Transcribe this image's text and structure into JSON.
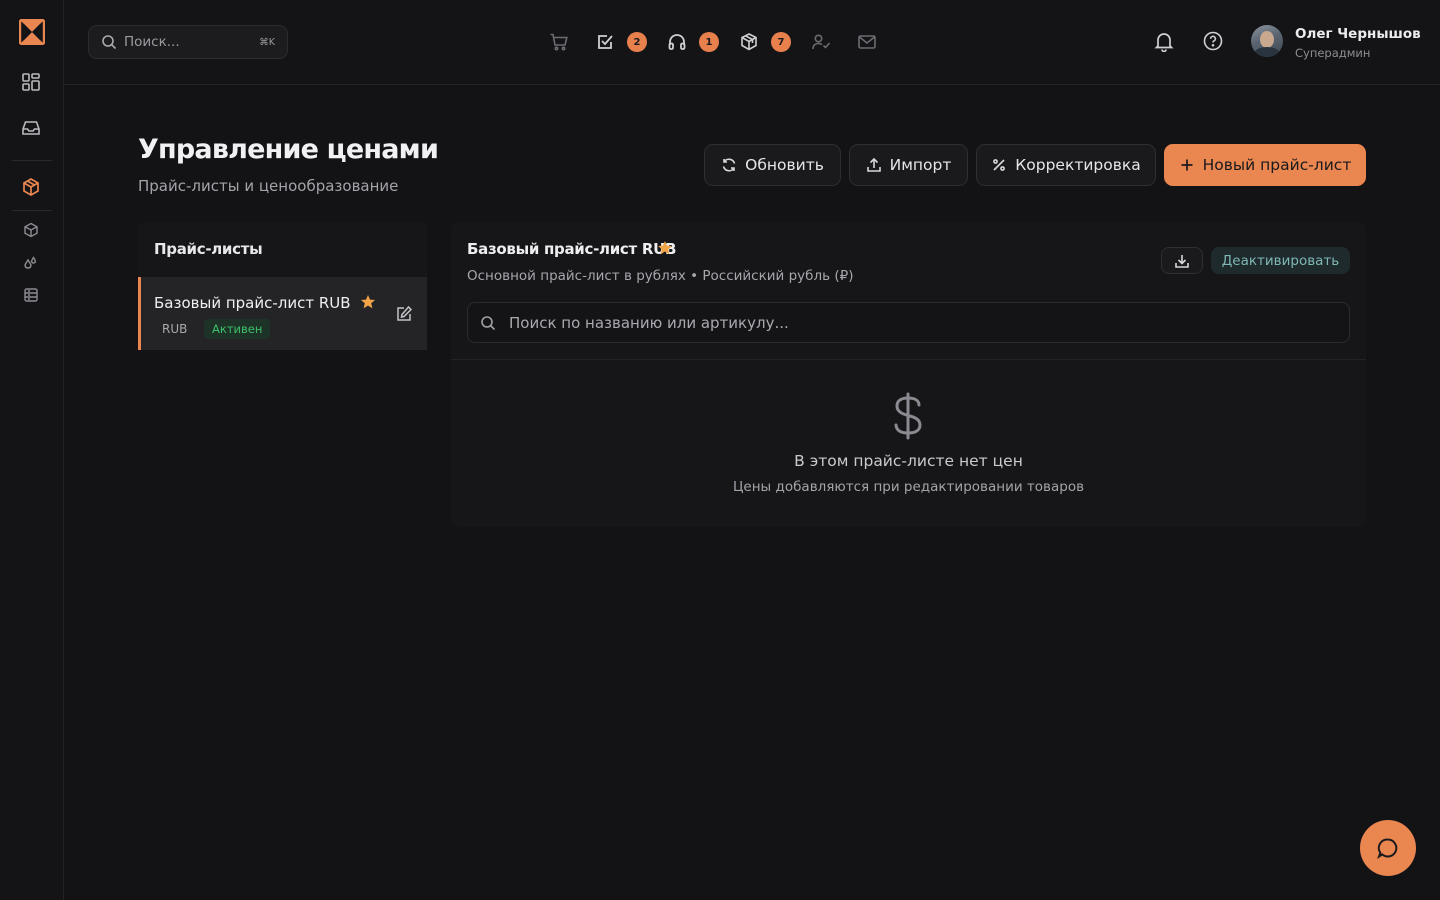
{
  "topbar": {
    "search_placeholder": "Поиск...",
    "search_shortcut": "⌘K",
    "quick_icons": [
      {
        "name": "cart-icon",
        "badge": null
      },
      {
        "name": "task-check-icon",
        "badge": "2"
      },
      {
        "name": "headphones-icon",
        "badge": "1"
      },
      {
        "name": "package-icon",
        "badge": "7"
      },
      {
        "name": "user-check-icon",
        "badge": null
      },
      {
        "name": "mail-icon",
        "badge": null
      }
    ],
    "user": {
      "name": "Олег Чернышов",
      "role": "Суперадмин"
    }
  },
  "page": {
    "title": "Управление ценами",
    "subtitle": "Прайс-листы и ценообразование"
  },
  "actions": {
    "refresh": "Обновить",
    "import": "Импорт",
    "adjust": "Корректировка",
    "new_pricelist": "Новый прайс-лист"
  },
  "pricelists": {
    "heading": "Прайс-листы",
    "items": [
      {
        "name": "Базовый прайс-лист RUB",
        "currency": "RUB",
        "status": "Активен",
        "default": true
      }
    ]
  },
  "detail": {
    "title": "Базовый прайс-лист RUB",
    "subtitle": "Основной прайс-лист в рублях • Российский рубль (₽)",
    "deactivate": "Деактивировать",
    "search_placeholder": "Поиск по названию или артикулу...",
    "empty_title": "В этом прайс-листе нет цен",
    "empty_subtitle": "Цены добавляются при редактировании товаров"
  },
  "colors": {
    "accent": "#ea8650",
    "star": "#f2a446",
    "active_status": "#3fbf6a"
  }
}
